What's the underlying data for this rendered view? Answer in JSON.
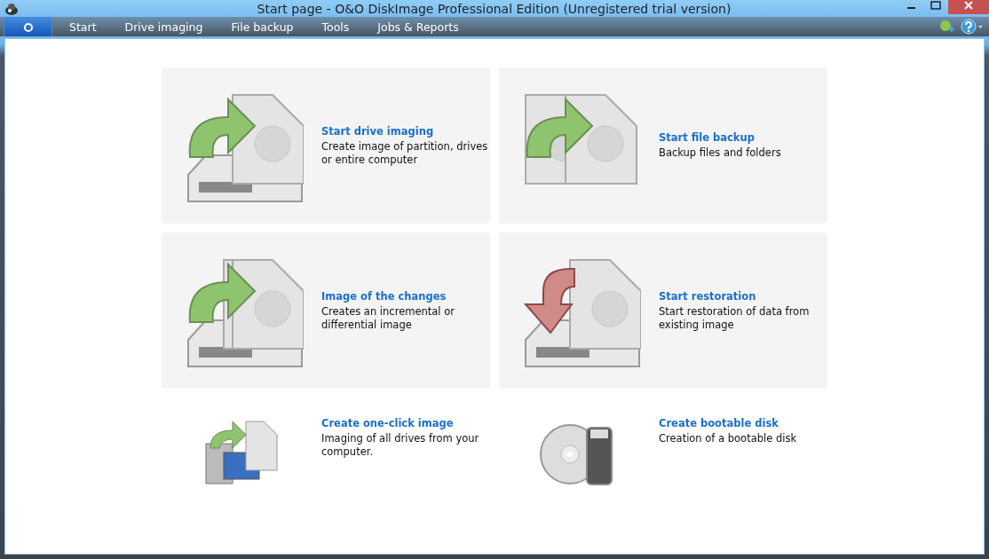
{
  "window": {
    "title": "Start page - O&O DiskImage Professional Edition (Unregistered trial version)"
  },
  "tabs": [
    {
      "label": "Start",
      "selected": false
    },
    {
      "label": "Drive imaging",
      "selected": false
    },
    {
      "label": "File backup",
      "selected": false
    },
    {
      "label": "Tools",
      "selected": false
    },
    {
      "label": "Jobs & Reports",
      "selected": false
    }
  ],
  "tiles": [
    {
      "kind": "card",
      "title": "Start drive imaging",
      "description": "Create image of partition, drives or entire computer"
    },
    {
      "kind": "card",
      "title": "Start file backup",
      "description": "Backup files and folders"
    },
    {
      "kind": "card",
      "title": "Image of the changes",
      "description": "Creates an incremental or differential image"
    },
    {
      "kind": "card",
      "title": "Start restoration",
      "description": "Start restoration of data from existing image"
    },
    {
      "kind": "plain",
      "title": "Create one-click image",
      "description": "Imaging of all drives from your computer."
    },
    {
      "kind": "plain",
      "title": "Create bootable disk",
      "description": "Creation of a bootable disk"
    }
  ]
}
